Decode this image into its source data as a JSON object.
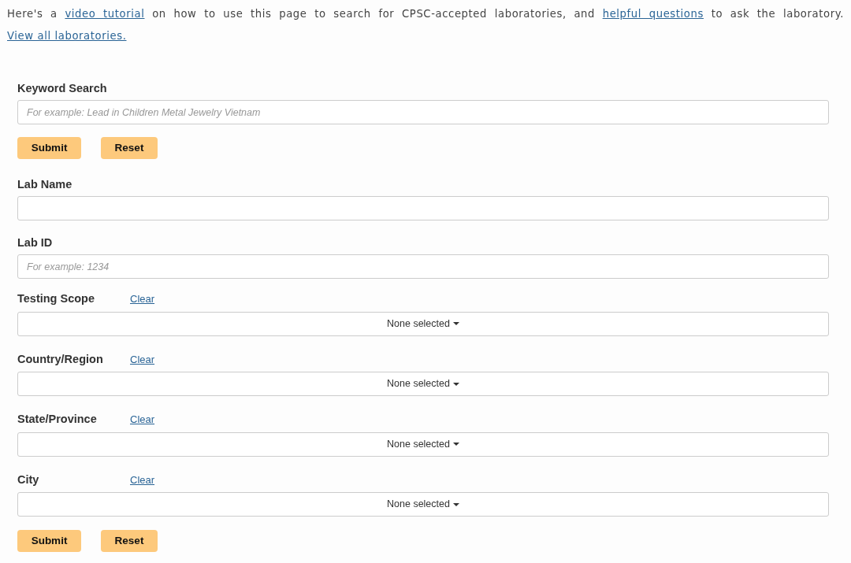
{
  "intro": [
    {
      "kind": "text",
      "text": "Here's a "
    },
    {
      "kind": "link",
      "text": "video tutorial"
    },
    {
      "kind": "text",
      "text": " on how to use this page to search for CPSC-accepted laboratories, and "
    },
    {
      "kind": "link",
      "text": "helpful questions"
    },
    {
      "kind": "text",
      "text": " to ask the laboratory. "
    },
    {
      "kind": "link",
      "text": "View all laboratories."
    }
  ],
  "form": [
    {
      "kind": "text",
      "label": "Keyword Search",
      "placeholder": "For example: Lead in Children Metal Jewelry Vietnam"
    },
    {
      "kind": "buttons",
      "buttons": [
        "Submit",
        "Reset"
      ]
    },
    {
      "kind": "text",
      "label": "Lab Name"
    },
    {
      "kind": "text",
      "label": "Lab ID",
      "placeholder": "For example: 1234"
    },
    {
      "kind": "select",
      "label": "Testing Scope",
      "clear": "Clear",
      "value": "None selected"
    },
    {
      "kind": "select",
      "label": "Country/Region",
      "clear": "Clear",
      "value": "None selected"
    },
    {
      "kind": "select",
      "label": "State/Province",
      "clear": "Clear",
      "value": "None selected"
    },
    {
      "kind": "select",
      "label": "City",
      "clear": "Clear",
      "value": "None selected"
    },
    {
      "kind": "buttons",
      "buttons": [
        "Submit",
        "Reset"
      ]
    }
  ]
}
